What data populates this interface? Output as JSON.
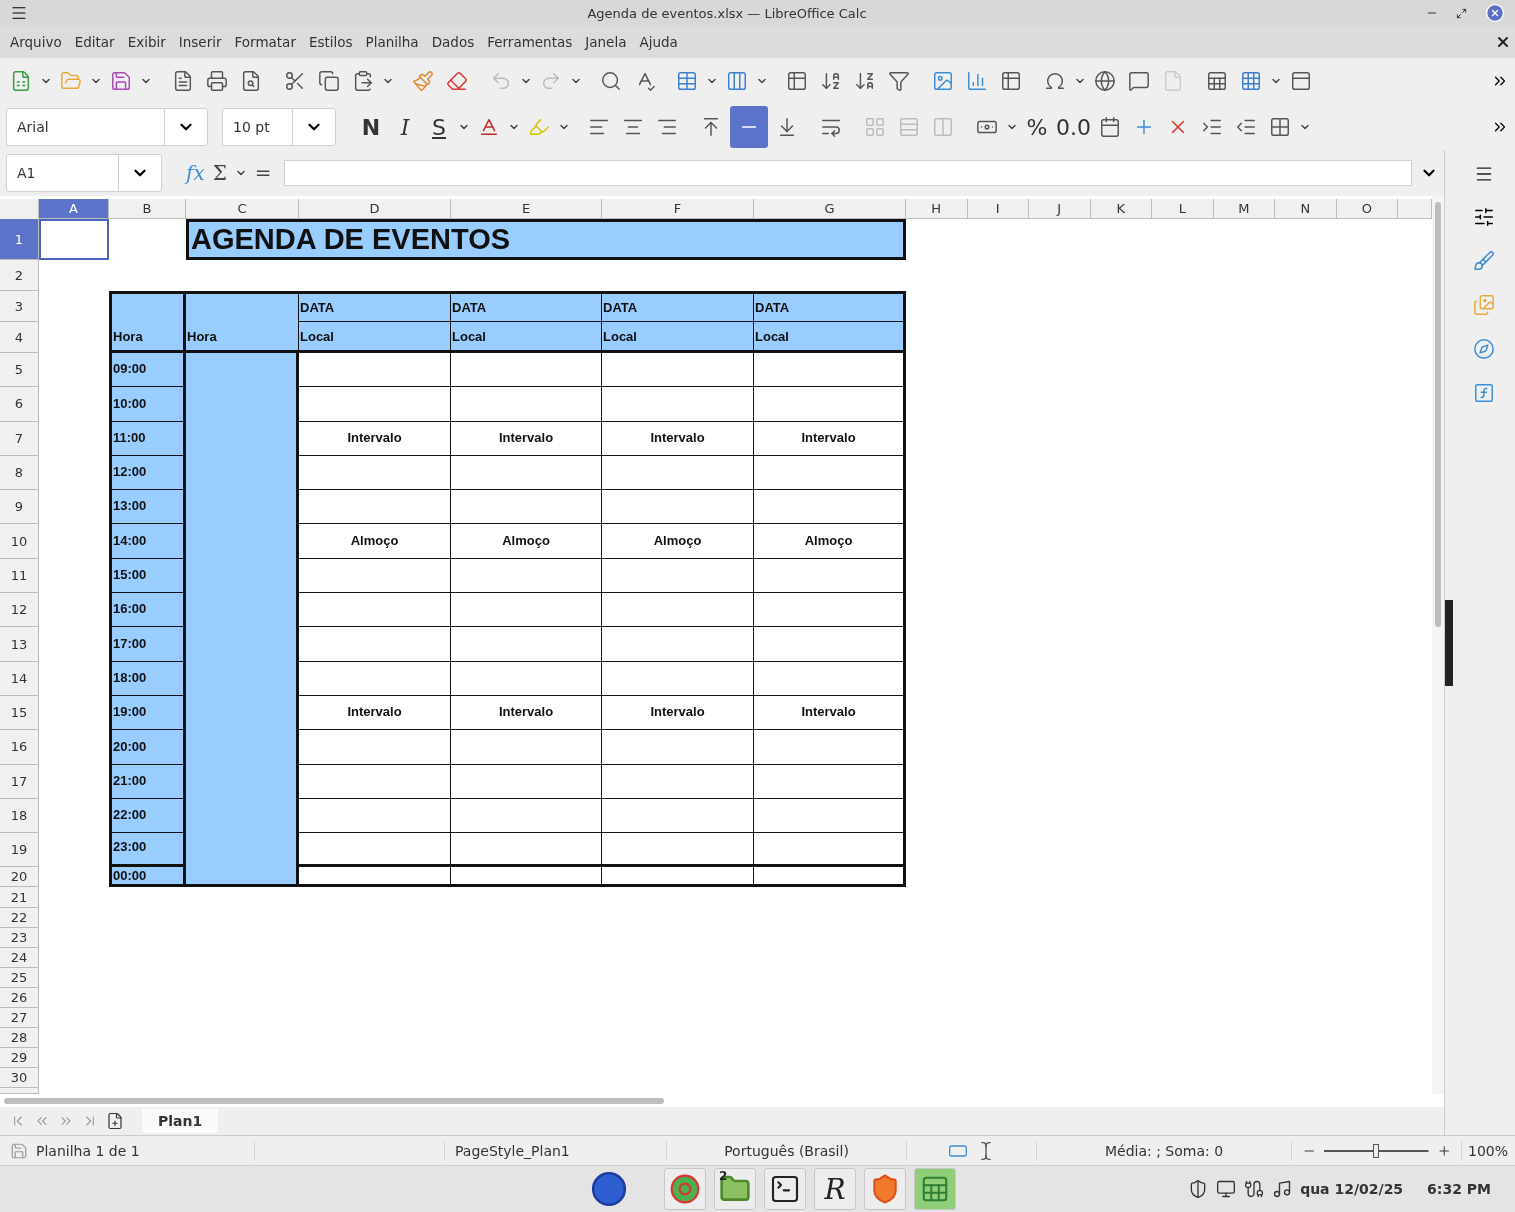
{
  "window": {
    "title": "Agenda de eventos.xlsx — LibreOffice Calc"
  },
  "menu": [
    "Arquivo",
    "Editar",
    "Exibir",
    "Inserir",
    "Formatar",
    "Estilos",
    "Planilha",
    "Dados",
    "Ferramentas",
    "Janela",
    "Ajuda"
  ],
  "formatting": {
    "font_name": "Arial",
    "font_size": "10 pt",
    "style_buttons": [
      "N",
      "I",
      "S"
    ],
    "vertical_align": [
      {
        "selected": false
      },
      {
        "selected": true
      },
      {
        "selected": false
      }
    ],
    "number_buttons": [
      "%",
      "0.0"
    ]
  },
  "formula_bar": {
    "name_box": "A1",
    "symbols": [
      "fx",
      "Σ",
      "="
    ]
  },
  "columns": [
    {
      "label": "A",
      "selected": true
    },
    {
      "label": "B",
      "selected": false
    },
    {
      "label": "C",
      "selected": false
    },
    {
      "label": "D",
      "selected": false
    },
    {
      "label": "E",
      "selected": false
    },
    {
      "label": "F",
      "selected": false
    },
    {
      "label": "G",
      "selected": false
    },
    {
      "label": "H",
      "selected": false
    },
    {
      "label": "I",
      "selected": false
    },
    {
      "label": "J",
      "selected": false
    },
    {
      "label": "K",
      "selected": false
    },
    {
      "label": "L",
      "selected": false
    },
    {
      "label": "M",
      "selected": false
    },
    {
      "label": "N",
      "selected": false
    },
    {
      "label": "O",
      "selected": false
    }
  ],
  "rows": [
    {
      "label": "1",
      "selected": true
    },
    {
      "label": "2",
      "selected": false
    },
    {
      "label": "3",
      "selected": false
    },
    {
      "label": "4",
      "selected": false
    },
    {
      "label": "5",
      "selected": false
    },
    {
      "label": "6",
      "selected": false
    },
    {
      "label": "7",
      "selected": false
    },
    {
      "label": "8",
      "selected": false
    },
    {
      "label": "9",
      "selected": false
    },
    {
      "label": "10",
      "selected": false
    },
    {
      "label": "11",
      "selected": false
    },
    {
      "label": "12",
      "selected": false
    },
    {
      "label": "13",
      "selected": false
    },
    {
      "label": "14",
      "selected": false
    },
    {
      "label": "15",
      "selected": false
    },
    {
      "label": "16",
      "selected": false
    },
    {
      "label": "17",
      "selected": false
    },
    {
      "label": "18",
      "selected": false
    },
    {
      "label": "19",
      "selected": false
    },
    {
      "label": "20",
      "selected": false
    },
    {
      "label": "21",
      "selected": false
    },
    {
      "label": "22",
      "selected": false
    },
    {
      "label": "23",
      "selected": false
    },
    {
      "label": "24",
      "selected": false
    },
    {
      "label": "25",
      "selected": false
    },
    {
      "label": "26",
      "selected": false
    },
    {
      "label": "27",
      "selected": false
    },
    {
      "label": "28",
      "selected": false
    },
    {
      "label": "29",
      "selected": false
    },
    {
      "label": "30",
      "selected": false
    }
  ],
  "sheet": {
    "title": "AGENDA DE EVENTOS",
    "date_headers": [
      "DATA",
      "DATA",
      "DATA",
      "DATA"
    ],
    "time_headers": [
      "Hora",
      "Hora"
    ],
    "place_headers": [
      "Local",
      "Local",
      "Local",
      "Local"
    ],
    "schedule": [
      {
        "time": "09:00"
      },
      {
        "time": "10:00"
      },
      {
        "time": "11:00",
        "events": [
          "Intervalo",
          "Intervalo",
          "Intervalo",
          "Intervalo"
        ]
      },
      {
        "time": "12:00"
      },
      {
        "time": "13:00"
      },
      {
        "time": "14:00",
        "events": [
          "Almoço",
          "Almoço",
          "Almoço",
          "Almoço"
        ]
      },
      {
        "time": "15:00"
      },
      {
        "time": "16:00"
      },
      {
        "time": "17:00"
      },
      {
        "time": "18:00"
      },
      {
        "time": "19:00",
        "events": [
          "Intervalo",
          "Intervalo",
          "Intervalo",
          "Intervalo"
        ]
      },
      {
        "time": "20:00"
      },
      {
        "time": "21:00"
      },
      {
        "time": "22:00"
      },
      {
        "time": "23:00"
      },
      {
        "time": "00:00"
      }
    ]
  },
  "sheet_tabs": [
    {
      "label": "Plan1",
      "selected": true
    }
  ],
  "status_bar": {
    "sheet": "Planilha 1 de 1",
    "page_style": "PageStyle_Plan1",
    "language": "Português (Brasil)",
    "summary": "Média: ; Soma: 0",
    "zoom": {
      "level": 0.5
    },
    "zoom_reading": "100%"
  },
  "taskbar": {
    "folder_badge": "2",
    "r_app": "R",
    "date": "qua 12/02/25",
    "time": "6:32 PM"
  }
}
